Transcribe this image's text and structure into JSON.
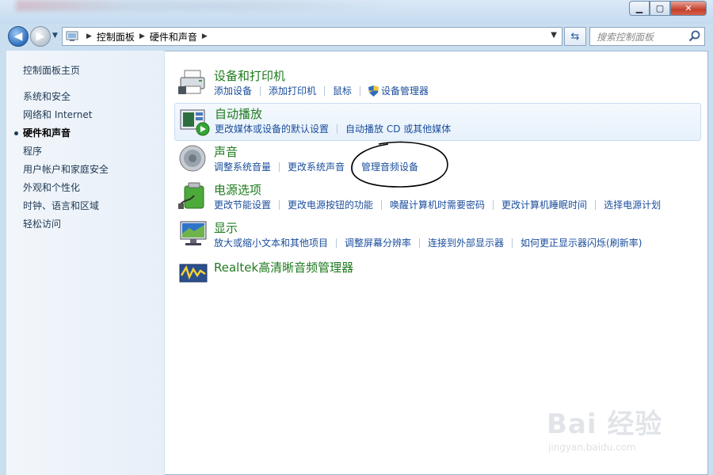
{
  "window": {
    "minimize_glyph": "▁",
    "maximize_glyph": "▢",
    "close_glyph": "✕"
  },
  "address_bar": {
    "breadcrumbs": [
      "控制面板",
      "硬件和声音"
    ],
    "search_placeholder": "搜索控制面板"
  },
  "sidebar": {
    "home": "控制面板主页",
    "items": [
      "系统和安全",
      "网络和 Internet",
      "硬件和声音",
      "程序",
      "用户帐户和家庭安全",
      "外观和个性化",
      "时钟、语言和区域",
      "轻松访问"
    ],
    "current_index": 2
  },
  "categories": [
    {
      "title": "设备和打印机",
      "icon": "printer-icon",
      "links": [
        "添加设备",
        "添加打印机",
        "鼠标",
        "设备管理器"
      ]
    },
    {
      "title": "自动播放",
      "icon": "autoplay-icon",
      "links": [
        "更改媒体或设备的默认设置",
        "自动播放 CD 或其他媒体"
      ]
    },
    {
      "title": "声音",
      "icon": "speaker-icon",
      "links": [
        "调整系统音量",
        "更改系统声音",
        "管理音频设备"
      ]
    },
    {
      "title": "电源选项",
      "icon": "power-options-icon",
      "links": [
        "更改节能设置",
        "更改电源按钮的功能",
        "唤醒计算机时需要密码",
        "更改计算机睡眠时间",
        "选择电源计划"
      ]
    },
    {
      "title": "显示",
      "icon": "display-icon",
      "links": [
        "放大或缩小文本和其他项目",
        "调整屏幕分辨率",
        "连接到外部显示器",
        "如何更正显示器闪烁(刷新率)"
      ]
    },
    {
      "title": "Realtek高清晰音频管理器",
      "icon": "realtek-audio-icon",
      "links": []
    }
  ],
  "watermark": {
    "brand": "Bai 经验",
    "url": "jingyan.baidu.com"
  },
  "colors": {
    "category_title": "#1f7a1f",
    "link": "#1a4d9c",
    "sidebar_bg": "#eef3fa",
    "highlight_bg": "#e7f1fb"
  }
}
